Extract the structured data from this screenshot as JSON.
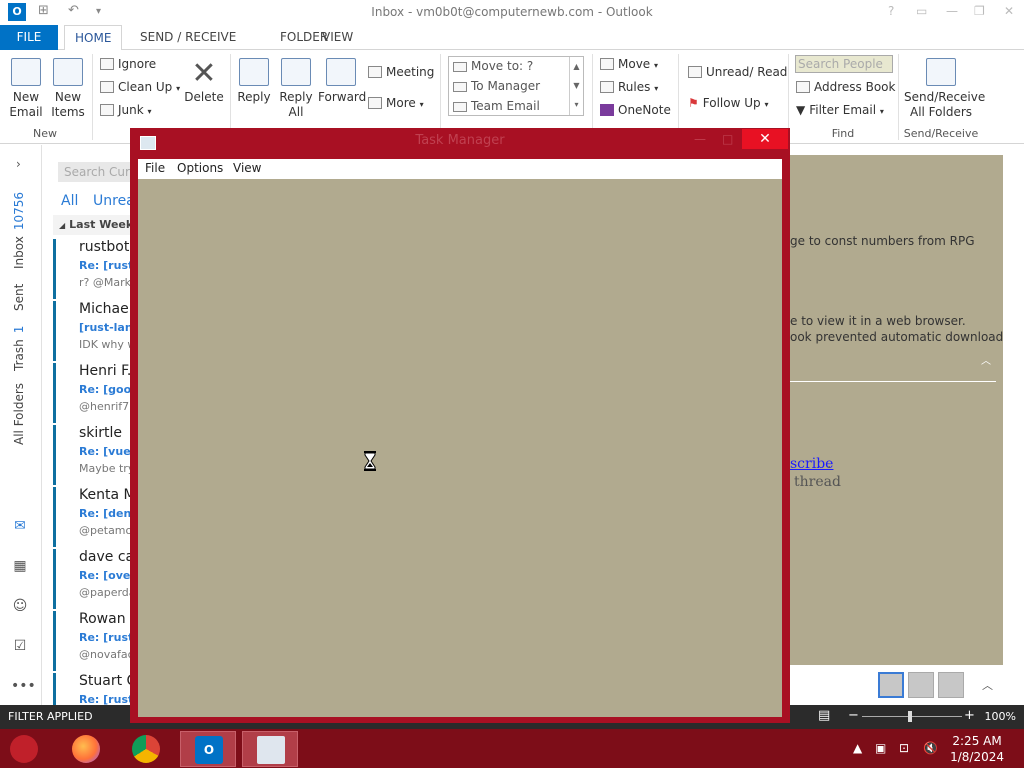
{
  "window": {
    "title": "Inbox - vm0b0t@computernewb.com - Outlook",
    "help": "?",
    "controls": [
      "▭",
      "—",
      "❐",
      "✕"
    ]
  },
  "quick_access": {
    "app_icon": "O",
    "undo": "↶"
  },
  "ribbon": {
    "tabs": [
      "FILE",
      "HOME",
      "SEND / RECEIVE",
      "FOLDER",
      "VIEW"
    ],
    "new_email": "New\nEmail",
    "new_items": "New\nItems",
    "group_new": "New",
    "ignore": "Ignore",
    "clean_up": "Clean Up",
    "junk": "Junk",
    "delete": "Delete",
    "reply": "Reply",
    "reply_all": "Reply\nAll",
    "forward": "Forward",
    "meeting": "Meeting",
    "more": "More",
    "quick_steps": [
      "Move to: ?",
      "To Manager",
      "Team Email"
    ],
    "move": "Move",
    "rules": "Rules",
    "onenote": "OneNote",
    "unread_read": "Unread/ Read",
    "follow_up": "Follow Up",
    "search_people": "Search People",
    "address_book": "Address Book",
    "filter_email": "Filter Email",
    "group_find": "Find",
    "send_receive_all": "Send/Receive\nAll Folders",
    "group_send_receive": "Send/Receive"
  },
  "nav": {
    "inbox_label": "Inbox",
    "inbox_count": "10756",
    "sent_label": "Sent",
    "trash_label": "Trash",
    "trash_count": "1",
    "all_folders_label": "All Folders"
  },
  "list": {
    "search_placeholder": "Search Curre",
    "filter_all": "All",
    "filter_unread": "Unrea",
    "group_header": "Last Week",
    "messages": [
      {
        "sender": "rustbot",
        "subject": "Re: [rust-l",
        "preview": "r? @Mark-"
      },
      {
        "sender": "Michael",
        "subject": "[rust-lang",
        "preview": "IDK why w"
      },
      {
        "sender": "Henri F.",
        "subject": "Re: [goog",
        "preview": "@henrif75"
      },
      {
        "sender": "skirtle",
        "subject": "Re: [vuejs",
        "preview": "Maybe try"
      },
      {
        "sender": "Kenta M",
        "subject": "Re: [deno",
        "preview": "@petamo"
      },
      {
        "sender": "dave ca",
        "subject": "Re: [oven-",
        "preview": "@paperda"
      },
      {
        "sender": "Rowan",
        "subject": "Re: [rust-l",
        "preview": "@novafac"
      },
      {
        "sender": "Stuart C",
        "subject": "Re: [rust-l",
        "preview": ""
      }
    ]
  },
  "reading": {
    "line1": "ge to const numbers from RPG",
    "line2": "e to view it in a web browser.",
    "line3": "ook prevented automatic download",
    "link": "scribe",
    "link_suffix": ".",
    "thread": "thread",
    "thread_suffix": "."
  },
  "statusbar": {
    "filter": "FILTER APPLIED",
    "zoom": "100%"
  },
  "task_manager": {
    "title": "Task Manager",
    "menu": [
      "File",
      "Options",
      "View"
    ],
    "close": "✕"
  },
  "taskbar": {
    "time": "2:25 AM",
    "date": "1/8/2024"
  },
  "colors": {
    "accent": "#0072c6",
    "task_manager_frame": "#a81023",
    "task_manager_body": "#b1aa8f",
    "taskbar": "#7d0d18"
  }
}
